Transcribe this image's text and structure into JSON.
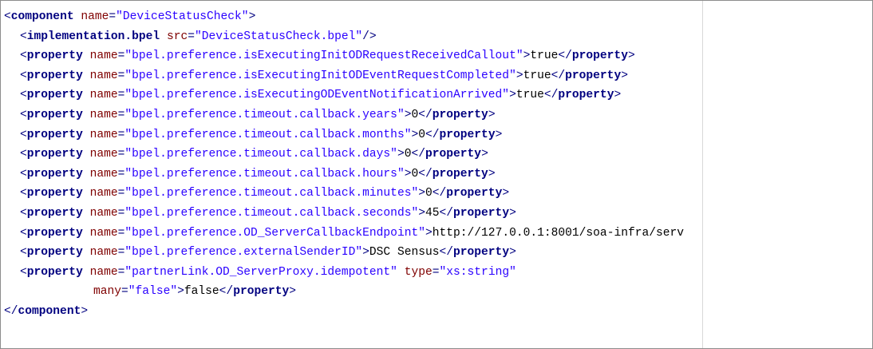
{
  "editor": {
    "lines": [
      [
        [
          "br",
          "<"
        ],
        [
          "tag",
          "component"
        ],
        [
          "txt",
          " "
        ],
        [
          "attr",
          "name"
        ],
        [
          "br",
          "="
        ],
        [
          "val",
          "\"DeviceStatusCheck\""
        ],
        [
          "br",
          ">"
        ]
      ],
      [
        [
          "br",
          "<"
        ],
        [
          "tag",
          "implementation.bpel"
        ],
        [
          "txt",
          " "
        ],
        [
          "attr",
          "src"
        ],
        [
          "br",
          "="
        ],
        [
          "val",
          "\"DeviceStatusCheck.bpel\""
        ],
        [
          "br",
          "/>"
        ]
      ],
      [
        [
          "br",
          "<"
        ],
        [
          "tag",
          "property"
        ],
        [
          "txt",
          " "
        ],
        [
          "attr",
          "name"
        ],
        [
          "br",
          "="
        ],
        [
          "val",
          "\"bpel.preference.isExecutingInitODRequestReceivedCallout\""
        ],
        [
          "br",
          ">"
        ],
        [
          "txt",
          "true"
        ],
        [
          "br",
          "</"
        ],
        [
          "tag",
          "property"
        ],
        [
          "br",
          ">"
        ]
      ],
      [
        [
          "br",
          "<"
        ],
        [
          "tag",
          "property"
        ],
        [
          "txt",
          " "
        ],
        [
          "attr",
          "name"
        ],
        [
          "br",
          "="
        ],
        [
          "val",
          "\"bpel.preference.isExecutingInitODEventRequestCompleted\""
        ],
        [
          "br",
          ">"
        ],
        [
          "txt",
          "true"
        ],
        [
          "br",
          "</"
        ],
        [
          "tag",
          "property"
        ],
        [
          "br",
          ">"
        ]
      ],
      [
        [
          "br",
          "<"
        ],
        [
          "tag",
          "property"
        ],
        [
          "txt",
          " "
        ],
        [
          "attr",
          "name"
        ],
        [
          "br",
          "="
        ],
        [
          "val",
          "\"bpel.preference.isExecutingODEventNotificationArrived\""
        ],
        [
          "br",
          ">"
        ],
        [
          "txt",
          "true"
        ],
        [
          "br",
          "</"
        ],
        [
          "tag",
          "property"
        ],
        [
          "br",
          ">"
        ]
      ],
      [
        [
          "br",
          "<"
        ],
        [
          "tag",
          "property"
        ],
        [
          "txt",
          " "
        ],
        [
          "attr",
          "name"
        ],
        [
          "br",
          "="
        ],
        [
          "val",
          "\"bpel.preference.timeout.callback.years\""
        ],
        [
          "br",
          ">"
        ],
        [
          "txt",
          "0"
        ],
        [
          "br",
          "</"
        ],
        [
          "tag",
          "property"
        ],
        [
          "br",
          ">"
        ]
      ],
      [
        [
          "br",
          "<"
        ],
        [
          "tag",
          "property"
        ],
        [
          "txt",
          " "
        ],
        [
          "attr",
          "name"
        ],
        [
          "br",
          "="
        ],
        [
          "val",
          "\"bpel.preference.timeout.callback.months\""
        ],
        [
          "br",
          ">"
        ],
        [
          "txt",
          "0"
        ],
        [
          "br",
          "</"
        ],
        [
          "tag",
          "property"
        ],
        [
          "br",
          ">"
        ]
      ],
      [
        [
          "br",
          "<"
        ],
        [
          "tag",
          "property"
        ],
        [
          "txt",
          " "
        ],
        [
          "attr",
          "name"
        ],
        [
          "br",
          "="
        ],
        [
          "val",
          "\"bpel.preference.timeout.callback.days\""
        ],
        [
          "br",
          ">"
        ],
        [
          "txt",
          "0"
        ],
        [
          "br",
          "</"
        ],
        [
          "tag",
          "property"
        ],
        [
          "br",
          ">"
        ]
      ],
      [
        [
          "br",
          "<"
        ],
        [
          "tag",
          "property"
        ],
        [
          "txt",
          " "
        ],
        [
          "attr",
          "name"
        ],
        [
          "br",
          "="
        ],
        [
          "val",
          "\"bpel.preference.timeout.callback.hours\""
        ],
        [
          "br",
          ">"
        ],
        [
          "txt",
          "0"
        ],
        [
          "br",
          "</"
        ],
        [
          "tag",
          "property"
        ],
        [
          "br",
          ">"
        ]
      ],
      [
        [
          "br",
          "<"
        ],
        [
          "tag",
          "property"
        ],
        [
          "txt",
          " "
        ],
        [
          "attr",
          "name"
        ],
        [
          "br",
          "="
        ],
        [
          "val",
          "\"bpel.preference.timeout.callback.minutes\""
        ],
        [
          "br",
          ">"
        ],
        [
          "txt",
          "0"
        ],
        [
          "br",
          "</"
        ],
        [
          "tag",
          "property"
        ],
        [
          "br",
          ">"
        ]
      ],
      [
        [
          "br",
          "<"
        ],
        [
          "tag",
          "property"
        ],
        [
          "txt",
          " "
        ],
        [
          "attr",
          "name"
        ],
        [
          "br",
          "="
        ],
        [
          "val",
          "\"bpel.preference.timeout.callback.seconds\""
        ],
        [
          "br",
          ">"
        ],
        [
          "txt",
          "45"
        ],
        [
          "br",
          "</"
        ],
        [
          "tag",
          "property"
        ],
        [
          "br",
          ">"
        ]
      ],
      [
        [
          "br",
          "<"
        ],
        [
          "tag",
          "property"
        ],
        [
          "txt",
          " "
        ],
        [
          "attr",
          "name"
        ],
        [
          "br",
          "="
        ],
        [
          "val",
          "\"bpel.preference.OD_ServerCallbackEndpoint\""
        ],
        [
          "br",
          ">"
        ],
        [
          "txt",
          "http://127.0.0.1:8001/soa-infra/serv"
        ]
      ],
      [
        [
          "br",
          "<"
        ],
        [
          "tag",
          "property"
        ],
        [
          "txt",
          " "
        ],
        [
          "attr",
          "name"
        ],
        [
          "br",
          "="
        ],
        [
          "val",
          "\"bpel.preference.externalSenderID\""
        ],
        [
          "br",
          ">"
        ],
        [
          "txt",
          "DSC Sensus"
        ],
        [
          "br",
          "</"
        ],
        [
          "tag",
          "property"
        ],
        [
          "br",
          ">"
        ]
      ],
      [
        [
          "br",
          "<"
        ],
        [
          "tag",
          "property"
        ],
        [
          "txt",
          " "
        ],
        [
          "attr",
          "name"
        ],
        [
          "br",
          "="
        ],
        [
          "val",
          "\"partnerLink.OD_ServerProxy.idempotent\""
        ],
        [
          "txt",
          " "
        ],
        [
          "attr",
          "type"
        ],
        [
          "br",
          "="
        ],
        [
          "val",
          "\"xs:string\""
        ]
      ],
      [
        [
          "attr",
          "many"
        ],
        [
          "br",
          "="
        ],
        [
          "val",
          "\"false\""
        ],
        [
          "br",
          ">"
        ],
        [
          "txt",
          "false"
        ],
        [
          "br",
          "</"
        ],
        [
          "tag",
          "property"
        ],
        [
          "br",
          ">"
        ]
      ],
      [
        [
          "br",
          "</"
        ],
        [
          "tag",
          "component"
        ],
        [
          "br",
          ">"
        ]
      ]
    ],
    "indents": [
      0,
      1,
      1,
      1,
      1,
      1,
      1,
      1,
      1,
      1,
      1,
      1,
      1,
      1,
      2,
      0
    ]
  }
}
